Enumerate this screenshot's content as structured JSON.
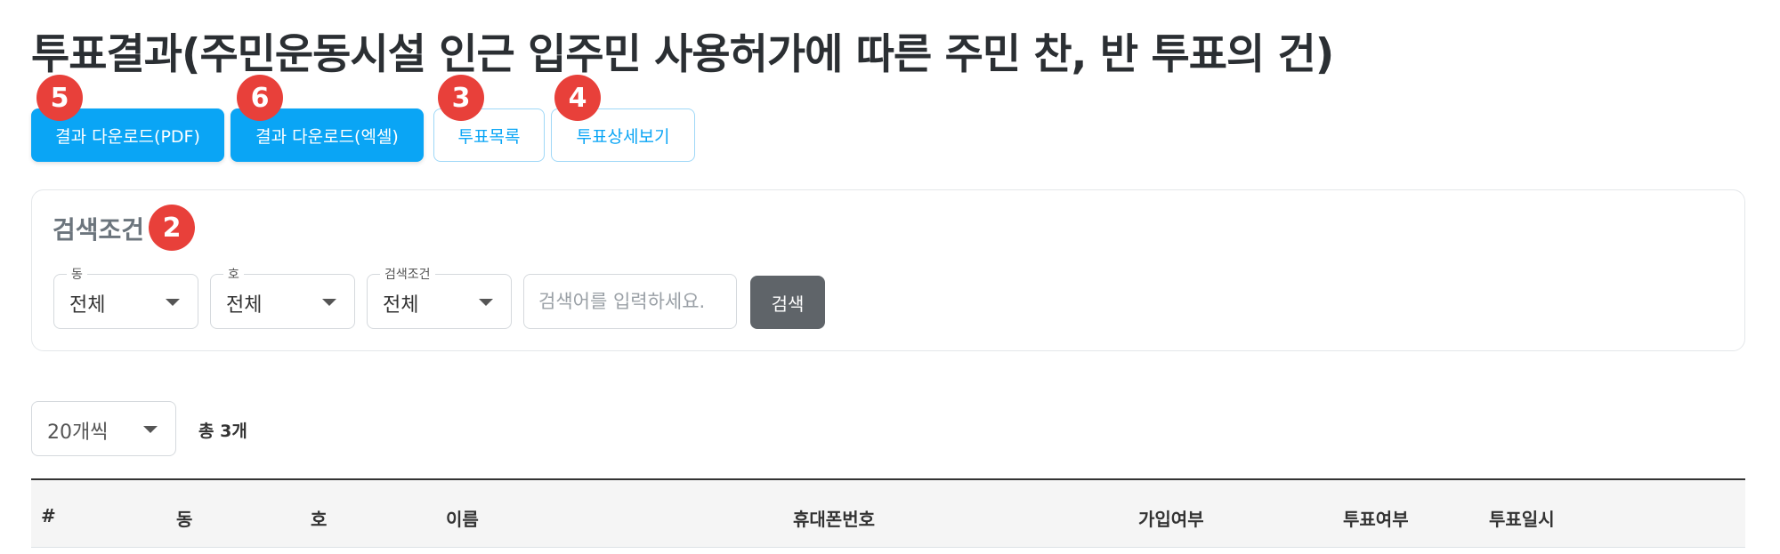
{
  "page": {
    "title": "투표결과(주민운동시설 인근 입주민 사용허가에 따른 주민 찬, 반 투표의 건)"
  },
  "toolbar": {
    "download_pdf_label": "결과 다운로드(PDF)",
    "download_excel_label": "결과 다운로드(엑셀)",
    "vote_list_label": "투표목록",
    "vote_detail_label": "투표상세보기"
  },
  "markers": {
    "pdf": "5",
    "excel": "6",
    "list": "3",
    "detail": "4",
    "search": "2"
  },
  "search": {
    "title": "검색조건",
    "dong": {
      "label": "동",
      "value": "전체"
    },
    "ho": {
      "label": "호",
      "value": "전체"
    },
    "condition": {
      "label": "검색조건",
      "value": "전체"
    },
    "keyword_placeholder": "검색어를 입력하세요.",
    "button_label": "검색"
  },
  "list": {
    "per_page": "20개씩",
    "total": "총 3개"
  },
  "table": {
    "headers": [
      "#",
      "동",
      "호",
      "이름",
      "휴대폰번호",
      "가입여부",
      "투표여부",
      "투표일시"
    ]
  },
  "colors": {
    "primary": "#0aa5f5",
    "marker": "#e8403a",
    "search_button": "#5f6469"
  }
}
